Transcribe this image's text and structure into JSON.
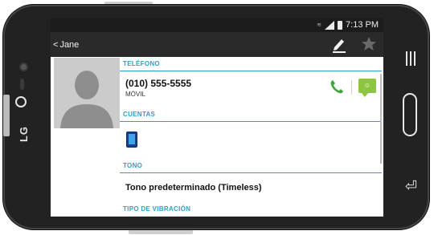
{
  "device": {
    "brand": "LG"
  },
  "status_bar": {
    "indicator": "≋",
    "time": "7:13 PM"
  },
  "action_bar": {
    "back_chevron": "<",
    "contact_name": "Jane",
    "edit_icon": "pencil-icon",
    "favorite_icon": "star-icon"
  },
  "sections": {
    "phone_header": "TELÉFONO",
    "accounts_header": "CUENTAS",
    "tone_header": "TONO",
    "vibration_header": "TIPO DE VIBRACIÓN"
  },
  "phone_entry": {
    "number": "(010) 555-5555",
    "type": "MÓVIL",
    "call_icon": "phone-call-icon",
    "message_icon": "message-icon"
  },
  "account": {
    "icon": "phone-device-icon"
  },
  "tone": {
    "value": "Tono predeterminado  (Timeless)"
  },
  "colors": {
    "accent": "#2e9fc5",
    "call_green": "#3fa63b",
    "message_green": "#8cc63f",
    "action_bar": "#2a2a2a"
  }
}
